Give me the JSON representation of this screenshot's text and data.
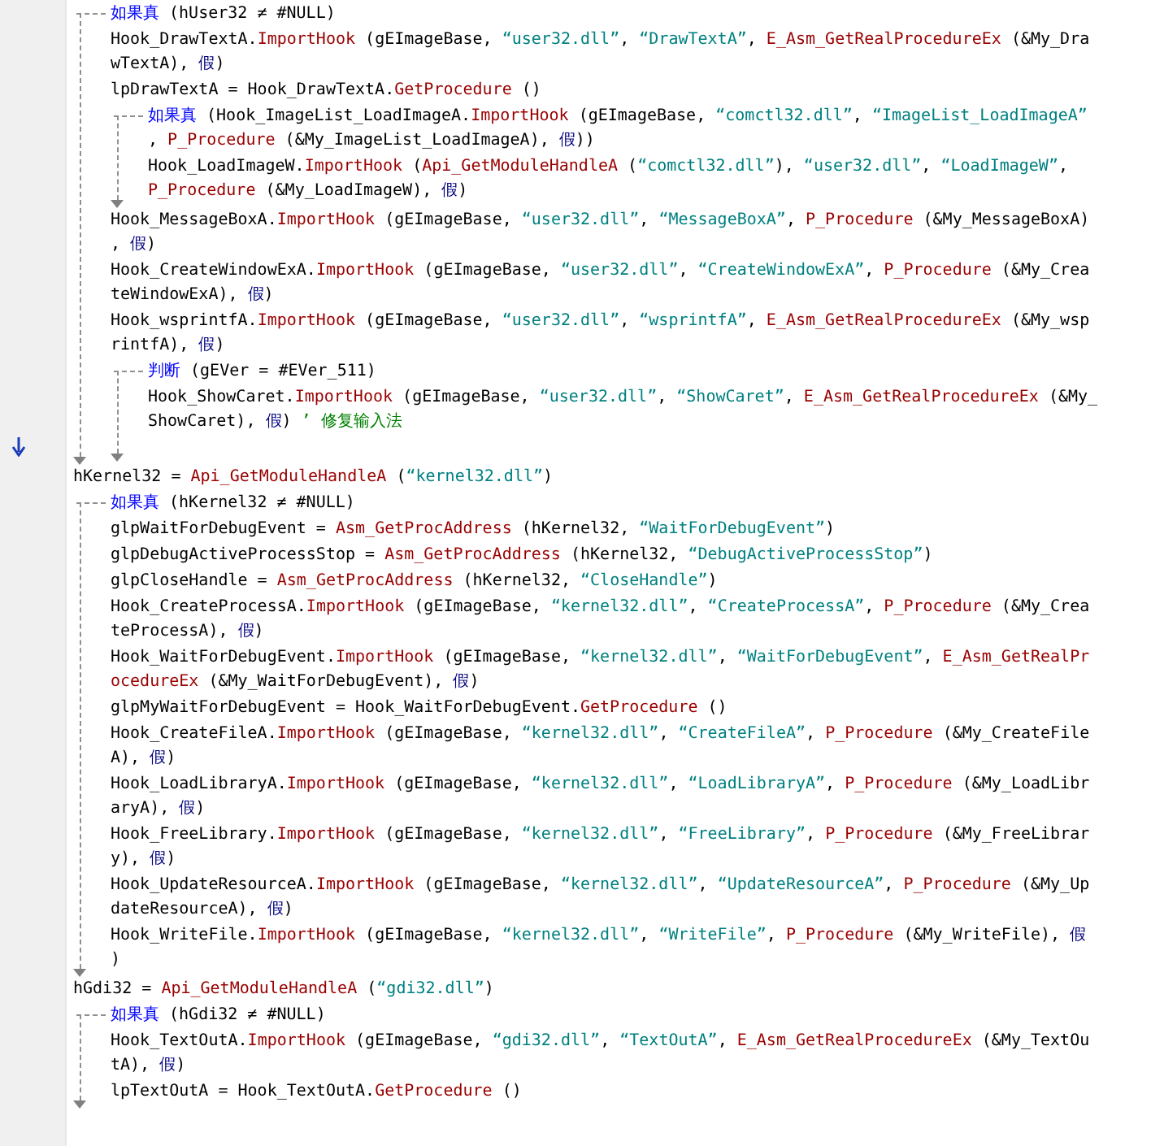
{
  "code": [
    {
      "kind": "if",
      "rows": [
        {
          "segments": [
            {
              "kind": "keyword",
              "text": "如果真"
            },
            {
              "kind": "plain",
              "text": " (hUser32 ≠ #NULL)"
            }
          ]
        }
      ],
      "children": [
        {
          "kind": "stmt",
          "rows": [
            {
              "segments": [
                {
                  "kind": "plain",
                  "text": "Hook_DrawTextA."
                },
                {
                  "kind": "call",
                  "text": "ImportHook"
                },
                {
                  "kind": "plain",
                  "text": " (gEImageBase, "
                },
                {
                  "kind": "string",
                  "text": "“user32.dll”"
                },
                {
                  "kind": "plain",
                  "text": ", "
                },
                {
                  "kind": "string",
                  "text": "“DrawTextA”"
                },
                {
                  "kind": "plain",
                  "text": ", "
                },
                {
                  "kind": "call",
                  "text": "E_Asm_GetRealProcedureEx"
                },
                {
                  "kind": "plain",
                  "text": " (&My_Dra"
                }
              ]
            },
            {
              "segments": [
                {
                  "kind": "plain",
                  "text": "wTextA), "
                },
                {
                  "kind": "bool",
                  "text": "假"
                },
                {
                  "kind": "plain",
                  "text": ")"
                }
              ]
            }
          ]
        },
        {
          "kind": "stmt",
          "rows": [
            {
              "segments": [
                {
                  "kind": "plain",
                  "text": "lpDrawTextA = Hook_DrawTextA."
                },
                {
                  "kind": "call",
                  "text": "GetProcedure"
                },
                {
                  "kind": "plain",
                  "text": " ()"
                }
              ]
            }
          ]
        },
        {
          "kind": "if",
          "rows": [
            {
              "segments": [
                {
                  "kind": "keyword",
                  "text": "如果真"
                },
                {
                  "kind": "plain",
                  "text": " (Hook_ImageList_LoadImageA."
                },
                {
                  "kind": "call",
                  "text": "ImportHook"
                },
                {
                  "kind": "plain",
                  "text": " (gEImageBase, "
                },
                {
                  "kind": "string",
                  "text": "“comctl32.dll”"
                },
                {
                  "kind": "plain",
                  "text": ", "
                },
                {
                  "kind": "string",
                  "text": "“ImageList_LoadImageA”"
                }
              ]
            },
            {
              "segments": [
                {
                  "kind": "plain",
                  "text": ", "
                },
                {
                  "kind": "call",
                  "text": "P_Procedure"
                },
                {
                  "kind": "plain",
                  "text": " (&My_ImageList_LoadImageA), "
                },
                {
                  "kind": "bool",
                  "text": "假"
                },
                {
                  "kind": "plain",
                  "text": "))"
                }
              ]
            }
          ],
          "children": [
            {
              "kind": "stmt",
              "rows": [
                {
                  "segments": [
                    {
                      "kind": "plain",
                      "text": "Hook_LoadImageW."
                    },
                    {
                      "kind": "call",
                      "text": "ImportHook"
                    },
                    {
                      "kind": "plain",
                      "text": " ("
                    },
                    {
                      "kind": "call",
                      "text": "Api_GetModuleHandleA"
                    },
                    {
                      "kind": "plain",
                      "text": " ("
                    },
                    {
                      "kind": "string",
                      "text": "“comctl32.dll”"
                    },
                    {
                      "kind": "plain",
                      "text": "), "
                    },
                    {
                      "kind": "string",
                      "text": "“user32.dll”"
                    },
                    {
                      "kind": "plain",
                      "text": ", "
                    },
                    {
                      "kind": "string",
                      "text": "“LoadImageW”"
                    },
                    {
                      "kind": "plain",
                      "text": ","
                    }
                  ]
                },
                {
                  "segments": [
                    {
                      "kind": "call",
                      "text": "P_Procedure"
                    },
                    {
                      "kind": "plain",
                      "text": " (&My_LoadImageW), "
                    },
                    {
                      "kind": "bool",
                      "text": "假"
                    },
                    {
                      "kind": "plain",
                      "text": ")"
                    }
                  ]
                }
              ]
            }
          ]
        },
        {
          "kind": "stmt",
          "rows": [
            {
              "segments": [
                {
                  "kind": "plain",
                  "text": "Hook_MessageBoxA."
                },
                {
                  "kind": "call",
                  "text": "ImportHook"
                },
                {
                  "kind": "plain",
                  "text": " (gEImageBase, "
                },
                {
                  "kind": "string",
                  "text": "“user32.dll”"
                },
                {
                  "kind": "plain",
                  "text": ", "
                },
                {
                  "kind": "string",
                  "text": "“MessageBoxA”"
                },
                {
                  "kind": "plain",
                  "text": ", "
                },
                {
                  "kind": "call",
                  "text": "P_Procedure"
                },
                {
                  "kind": "plain",
                  "text": " (&My_MessageBoxA)"
                }
              ]
            },
            {
              "segments": [
                {
                  "kind": "plain",
                  "text": ", "
                },
                {
                  "kind": "bool",
                  "text": "假"
                },
                {
                  "kind": "plain",
                  "text": ")"
                }
              ]
            }
          ]
        },
        {
          "kind": "stmt",
          "rows": [
            {
              "segments": [
                {
                  "kind": "plain",
                  "text": "Hook_CreateWindowExA."
                },
                {
                  "kind": "call",
                  "text": "ImportHook"
                },
                {
                  "kind": "plain",
                  "text": " (gEImageBase, "
                },
                {
                  "kind": "string",
                  "text": "“user32.dll”"
                },
                {
                  "kind": "plain",
                  "text": ", "
                },
                {
                  "kind": "string",
                  "text": "“CreateWindowExA”"
                },
                {
                  "kind": "plain",
                  "text": ", "
                },
                {
                  "kind": "call",
                  "text": "P_Procedure"
                },
                {
                  "kind": "plain",
                  "text": " (&My_Crea"
                }
              ]
            },
            {
              "segments": [
                {
                  "kind": "plain",
                  "text": "teWindowExA), "
                },
                {
                  "kind": "bool",
                  "text": "假"
                },
                {
                  "kind": "plain",
                  "text": ")"
                }
              ]
            }
          ]
        },
        {
          "kind": "stmt",
          "rows": [
            {
              "segments": [
                {
                  "kind": "plain",
                  "text": "Hook_wsprintfA."
                },
                {
                  "kind": "call",
                  "text": "ImportHook"
                },
                {
                  "kind": "plain",
                  "text": " (gEImageBase, "
                },
                {
                  "kind": "string",
                  "text": "“user32.dll”"
                },
                {
                  "kind": "plain",
                  "text": ", "
                },
                {
                  "kind": "string",
                  "text": "“wsprintfA”"
                },
                {
                  "kind": "plain",
                  "text": ", "
                },
                {
                  "kind": "call",
                  "text": "E_Asm_GetRealProcedureEx"
                },
                {
                  "kind": "plain",
                  "text": " (&My_wsp"
                }
              ]
            },
            {
              "segments": [
                {
                  "kind": "plain",
                  "text": "rintfA), "
                },
                {
                  "kind": "bool",
                  "text": "假"
                },
                {
                  "kind": "plain",
                  "text": ")"
                }
              ]
            }
          ]
        },
        {
          "kind": "judge",
          "rows": [
            {
              "segments": [
                {
                  "kind": "keyword",
                  "text": "判断"
                },
                {
                  "kind": "plain",
                  "text": " (gEVer = #EVer_511)"
                }
              ]
            }
          ],
          "children": [
            {
              "kind": "stmt",
              "rows": [
                {
                  "segments": [
                    {
                      "kind": "plain",
                      "text": "Hook_ShowCaret."
                    },
                    {
                      "kind": "call",
                      "text": "ImportHook"
                    },
                    {
                      "kind": "plain",
                      "text": " (gEImageBase, "
                    },
                    {
                      "kind": "string",
                      "text": "“user32.dll”"
                    },
                    {
                      "kind": "plain",
                      "text": ", "
                    },
                    {
                      "kind": "string",
                      "text": "“ShowCaret”"
                    },
                    {
                      "kind": "plain",
                      "text": ", "
                    },
                    {
                      "kind": "call",
                      "text": "E_Asm_GetRealProcedureEx"
                    },
                    {
                      "kind": "plain",
                      "text": " (&My_"
                    }
                  ]
                },
                {
                  "segments": [
                    {
                      "kind": "plain",
                      "text": "ShowCaret), "
                    },
                    {
                      "kind": "bool",
                      "text": "假"
                    },
                    {
                      "kind": "plain",
                      "text": ") "
                    },
                    {
                      "kind": "comment",
                      "text": "’ 修复输入法"
                    }
                  ]
                }
              ]
            }
          ]
        }
      ]
    },
    {
      "kind": "stmt",
      "marker": true,
      "rows": [
        {
          "segments": [
            {
              "kind": "plain",
              "text": "hKernel32 = "
            },
            {
              "kind": "call",
              "text": "Api_GetModuleHandleA"
            },
            {
              "kind": "plain",
              "text": " ("
            },
            {
              "kind": "string",
              "text": "“kernel32.dll”"
            },
            {
              "kind": "plain",
              "text": ")"
            }
          ]
        }
      ]
    },
    {
      "kind": "if",
      "rows": [
        {
          "segments": [
            {
              "kind": "keyword",
              "text": "如果真"
            },
            {
              "kind": "plain",
              "text": " (hKernel32 ≠ #NULL)"
            }
          ]
        }
      ],
      "children": [
        {
          "kind": "stmt",
          "rows": [
            {
              "segments": [
                {
                  "kind": "plain",
                  "text": "glpWaitForDebugEvent = "
                },
                {
                  "kind": "call",
                  "text": "Asm_GetProcAddress"
                },
                {
                  "kind": "plain",
                  "text": " (hKernel32, "
                },
                {
                  "kind": "string",
                  "text": "“WaitForDebugEvent”"
                },
                {
                  "kind": "plain",
                  "text": ")"
                }
              ]
            }
          ]
        },
        {
          "kind": "stmt",
          "rows": [
            {
              "segments": [
                {
                  "kind": "plain",
                  "text": "glpDebugActiveProcessStop = "
                },
                {
                  "kind": "call",
                  "text": "Asm_GetProcAddress"
                },
                {
                  "kind": "plain",
                  "text": " (hKernel32, "
                },
                {
                  "kind": "string",
                  "text": "“DebugActiveProcessStop”"
                },
                {
                  "kind": "plain",
                  "text": ")"
                }
              ]
            }
          ]
        },
        {
          "kind": "stmt",
          "rows": [
            {
              "segments": [
                {
                  "kind": "plain",
                  "text": "glpCloseHandle = "
                },
                {
                  "kind": "call",
                  "text": "Asm_GetProcAddress"
                },
                {
                  "kind": "plain",
                  "text": " (hKernel32, "
                },
                {
                  "kind": "string",
                  "text": "“CloseHandle”"
                },
                {
                  "kind": "plain",
                  "text": ")"
                }
              ]
            }
          ]
        },
        {
          "kind": "stmt",
          "rows": [
            {
              "segments": [
                {
                  "kind": "plain",
                  "text": "Hook_CreateProcessA."
                },
                {
                  "kind": "call",
                  "text": "ImportHook"
                },
                {
                  "kind": "plain",
                  "text": " (gEImageBase, "
                },
                {
                  "kind": "string",
                  "text": "“kernel32.dll”"
                },
                {
                  "kind": "plain",
                  "text": ", "
                },
                {
                  "kind": "string",
                  "text": "“CreateProcessA”"
                },
                {
                  "kind": "plain",
                  "text": ", "
                },
                {
                  "kind": "call",
                  "text": "P_Procedure"
                },
                {
                  "kind": "plain",
                  "text": " (&My_Crea"
                }
              ]
            },
            {
              "segments": [
                {
                  "kind": "plain",
                  "text": "teProcessA), "
                },
                {
                  "kind": "bool",
                  "text": "假"
                },
                {
                  "kind": "plain",
                  "text": ")"
                }
              ]
            }
          ]
        },
        {
          "kind": "stmt",
          "rows": [
            {
              "segments": [
                {
                  "kind": "plain",
                  "text": "Hook_WaitForDebugEvent."
                },
                {
                  "kind": "call",
                  "text": "ImportHook"
                },
                {
                  "kind": "plain",
                  "text": " (gEImageBase, "
                },
                {
                  "kind": "string",
                  "text": "“kernel32.dll”"
                },
                {
                  "kind": "plain",
                  "text": ", "
                },
                {
                  "kind": "string",
                  "text": "“WaitForDebugEvent”"
                },
                {
                  "kind": "plain",
                  "text": ", "
                },
                {
                  "kind": "call",
                  "text": "E_Asm_GetRealPr"
                }
              ]
            },
            {
              "segments": [
                {
                  "kind": "call",
                  "text": "ocedureEx"
                },
                {
                  "kind": "plain",
                  "text": " (&My_WaitForDebugEvent), "
                },
                {
                  "kind": "bool",
                  "text": "假"
                },
                {
                  "kind": "plain",
                  "text": ")"
                }
              ]
            }
          ]
        },
        {
          "kind": "stmt",
          "rows": [
            {
              "segments": [
                {
                  "kind": "plain",
                  "text": "glpMyWaitForDebugEvent = Hook_WaitForDebugEvent."
                },
                {
                  "kind": "call",
                  "text": "GetProcedure"
                },
                {
                  "kind": "plain",
                  "text": " ()"
                }
              ]
            }
          ]
        },
        {
          "kind": "stmt",
          "rows": [
            {
              "segments": [
                {
                  "kind": "plain",
                  "text": "Hook_CreateFileA."
                },
                {
                  "kind": "call",
                  "text": "ImportHook"
                },
                {
                  "kind": "plain",
                  "text": " (gEImageBase, "
                },
                {
                  "kind": "string",
                  "text": "“kernel32.dll”"
                },
                {
                  "kind": "plain",
                  "text": ", "
                },
                {
                  "kind": "string",
                  "text": "“CreateFileA”"
                },
                {
                  "kind": "plain",
                  "text": ", "
                },
                {
                  "kind": "call",
                  "text": "P_Procedure"
                },
                {
                  "kind": "plain",
                  "text": " (&My_CreateFile"
                }
              ]
            },
            {
              "segments": [
                {
                  "kind": "plain",
                  "text": "A), "
                },
                {
                  "kind": "bool",
                  "text": "假"
                },
                {
                  "kind": "plain",
                  "text": ")"
                }
              ]
            }
          ]
        },
        {
          "kind": "stmt",
          "rows": [
            {
              "segments": [
                {
                  "kind": "plain",
                  "text": "Hook_LoadLibraryA."
                },
                {
                  "kind": "call",
                  "text": "ImportHook"
                },
                {
                  "kind": "plain",
                  "text": " (gEImageBase, "
                },
                {
                  "kind": "string",
                  "text": "“kernel32.dll”"
                },
                {
                  "kind": "plain",
                  "text": ", "
                },
                {
                  "kind": "string",
                  "text": "“LoadLibraryA”"
                },
                {
                  "kind": "plain",
                  "text": ", "
                },
                {
                  "kind": "call",
                  "text": "P_Procedure"
                },
                {
                  "kind": "plain",
                  "text": " (&My_LoadLibr"
                }
              ]
            },
            {
              "segments": [
                {
                  "kind": "plain",
                  "text": "aryA), "
                },
                {
                  "kind": "bool",
                  "text": "假"
                },
                {
                  "kind": "plain",
                  "text": ")"
                }
              ]
            }
          ]
        },
        {
          "kind": "stmt",
          "rows": [
            {
              "segments": [
                {
                  "kind": "plain",
                  "text": "Hook_FreeLibrary."
                },
                {
                  "kind": "call",
                  "text": "ImportHook"
                },
                {
                  "kind": "plain",
                  "text": " (gEImageBase, "
                },
                {
                  "kind": "string",
                  "text": "“kernel32.dll”"
                },
                {
                  "kind": "plain",
                  "text": ", "
                },
                {
                  "kind": "string",
                  "text": "“FreeLibrary”"
                },
                {
                  "kind": "plain",
                  "text": ", "
                },
                {
                  "kind": "call",
                  "text": "P_Procedure"
                },
                {
                  "kind": "plain",
                  "text": " (&My_FreeLibrar"
                }
              ]
            },
            {
              "segments": [
                {
                  "kind": "plain",
                  "text": "y), "
                },
                {
                  "kind": "bool",
                  "text": "假"
                },
                {
                  "kind": "plain",
                  "text": ")"
                }
              ]
            }
          ]
        },
        {
          "kind": "stmt",
          "rows": [
            {
              "segments": [
                {
                  "kind": "plain",
                  "text": "Hook_UpdateResourceA."
                },
                {
                  "kind": "call",
                  "text": "ImportHook"
                },
                {
                  "kind": "plain",
                  "text": " (gEImageBase, "
                },
                {
                  "kind": "string",
                  "text": "“kernel32.dll”"
                },
                {
                  "kind": "plain",
                  "text": ", "
                },
                {
                  "kind": "string",
                  "text": "“UpdateResourceA”"
                },
                {
                  "kind": "plain",
                  "text": ", "
                },
                {
                  "kind": "call",
                  "text": "P_Procedure"
                },
                {
                  "kind": "plain",
                  "text": " (&My_Up"
                }
              ]
            },
            {
              "segments": [
                {
                  "kind": "plain",
                  "text": "dateResourceA), "
                },
                {
                  "kind": "bool",
                  "text": "假"
                },
                {
                  "kind": "plain",
                  "text": ")"
                }
              ]
            }
          ]
        },
        {
          "kind": "stmt",
          "rows": [
            {
              "segments": [
                {
                  "kind": "plain",
                  "text": "Hook_WriteFile."
                },
                {
                  "kind": "call",
                  "text": "ImportHook"
                },
                {
                  "kind": "plain",
                  "text": " (gEImageBase, "
                },
                {
                  "kind": "string",
                  "text": "“kernel32.dll”"
                },
                {
                  "kind": "plain",
                  "text": ", "
                },
                {
                  "kind": "string",
                  "text": "“WriteFile”"
                },
                {
                  "kind": "plain",
                  "text": ", "
                },
                {
                  "kind": "call",
                  "text": "P_Procedure"
                },
                {
                  "kind": "plain",
                  "text": " (&My_WriteFile), "
                },
                {
                  "kind": "bool",
                  "text": "假"
                }
              ]
            },
            {
              "segments": [
                {
                  "kind": "plain",
                  "text": ")"
                }
              ]
            }
          ]
        }
      ]
    },
    {
      "kind": "stmt",
      "rows": [
        {
          "segments": [
            {
              "kind": "plain",
              "text": "hGdi32 = "
            },
            {
              "kind": "call",
              "text": "Api_GetModuleHandleA"
            },
            {
              "kind": "plain",
              "text": " ("
            },
            {
              "kind": "string",
              "text": "“gdi32.dll”"
            },
            {
              "kind": "plain",
              "text": ")"
            }
          ]
        }
      ]
    },
    {
      "kind": "if",
      "rows": [
        {
          "segments": [
            {
              "kind": "keyword",
              "text": "如果真"
            },
            {
              "kind": "plain",
              "text": " (hGdi32 ≠ #NULL)"
            }
          ]
        }
      ],
      "children": [
        {
          "kind": "stmt",
          "rows": [
            {
              "segments": [
                {
                  "kind": "plain",
                  "text": "Hook_TextOutA."
                },
                {
                  "kind": "call",
                  "text": "ImportHook"
                },
                {
                  "kind": "plain",
                  "text": " (gEImageBase, "
                },
                {
                  "kind": "string",
                  "text": "“gdi32.dll”"
                },
                {
                  "kind": "plain",
                  "text": ", "
                },
                {
                  "kind": "string",
                  "text": "“TextOutA”"
                },
                {
                  "kind": "plain",
                  "text": ", "
                },
                {
                  "kind": "call",
                  "text": "E_Asm_GetRealProcedureEx"
                },
                {
                  "kind": "plain",
                  "text": " (&My_TextOu"
                }
              ]
            },
            {
              "segments": [
                {
                  "kind": "plain",
                  "text": "tA), "
                },
                {
                  "kind": "bool",
                  "text": "假"
                },
                {
                  "kind": "plain",
                  "text": ")"
                }
              ]
            }
          ]
        },
        {
          "kind": "stmt",
          "rows": [
            {
              "segments": [
                {
                  "kind": "plain",
                  "text": "lpTextOutA = Hook_TextOutA."
                },
                {
                  "kind": "call",
                  "text": "GetProcedure"
                },
                {
                  "kind": "plain",
                  "text": " ()"
                }
              ]
            }
          ]
        }
      ]
    }
  ]
}
